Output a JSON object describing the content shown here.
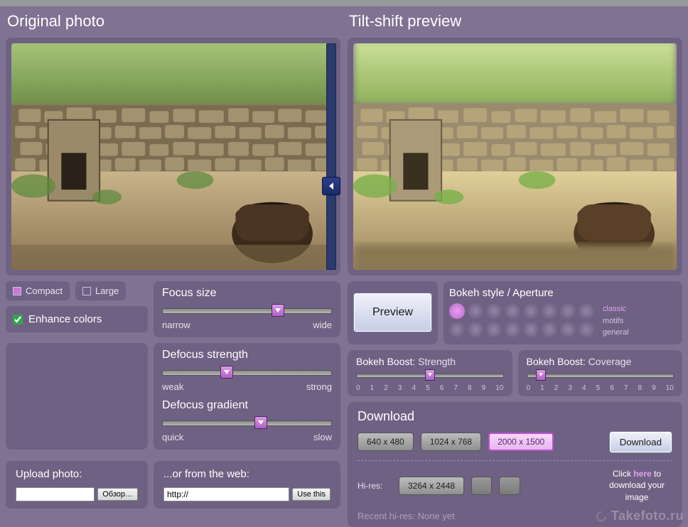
{
  "titles": {
    "original": "Original photo",
    "preview": "Tilt-shift preview"
  },
  "options": {
    "compact": "Compact",
    "large": "Large",
    "enhance": "Enhance colors",
    "enhance_checked": true
  },
  "sliders": {
    "focus": {
      "title": "Focus size",
      "min": "narrow",
      "max": "wide",
      "pos": 0.68
    },
    "defocus": {
      "title": "Defocus strength",
      "min": "weak",
      "max": "strong",
      "pos": 0.38
    },
    "gradient": {
      "title": "Defocus gradient",
      "min": "quick",
      "max": "slow",
      "pos": 0.58
    }
  },
  "preview_button": "Preview",
  "bokeh": {
    "title": "Bokeh style / Aperture",
    "labels": [
      "classic",
      "motifs",
      "general"
    ],
    "selected_label": "classic"
  },
  "boost": {
    "strength": {
      "title_a": "Bokeh Boost:",
      "title_b": "Strength",
      "pos": 5
    },
    "coverage": {
      "title_a": "Bokeh Boost:",
      "title_b": "Coverage",
      "pos": 1
    },
    "ticks": [
      "0",
      "1",
      "2",
      "3",
      "4",
      "5",
      "6",
      "7",
      "8",
      "9",
      "10"
    ]
  },
  "download": {
    "title": "Download",
    "sizes": [
      "640 x 480",
      "1024 x 768",
      "2000 x 1500"
    ],
    "selected_size_index": 2,
    "hires_label": "Hi-res:",
    "hires_size": "3264 x 2448",
    "button": "Download",
    "hint_pre": "Click ",
    "hint_link": "here",
    "hint_post": " to download your image",
    "recent_label": "Recent hi-res:",
    "recent_value": "None yet"
  },
  "upload": {
    "title": "Upload photo:",
    "browse": "Обзор…",
    "web_title": "...or from the web:",
    "url_value": "http://",
    "use_this": "Use this"
  },
  "watermark": "Takefoto.ru"
}
